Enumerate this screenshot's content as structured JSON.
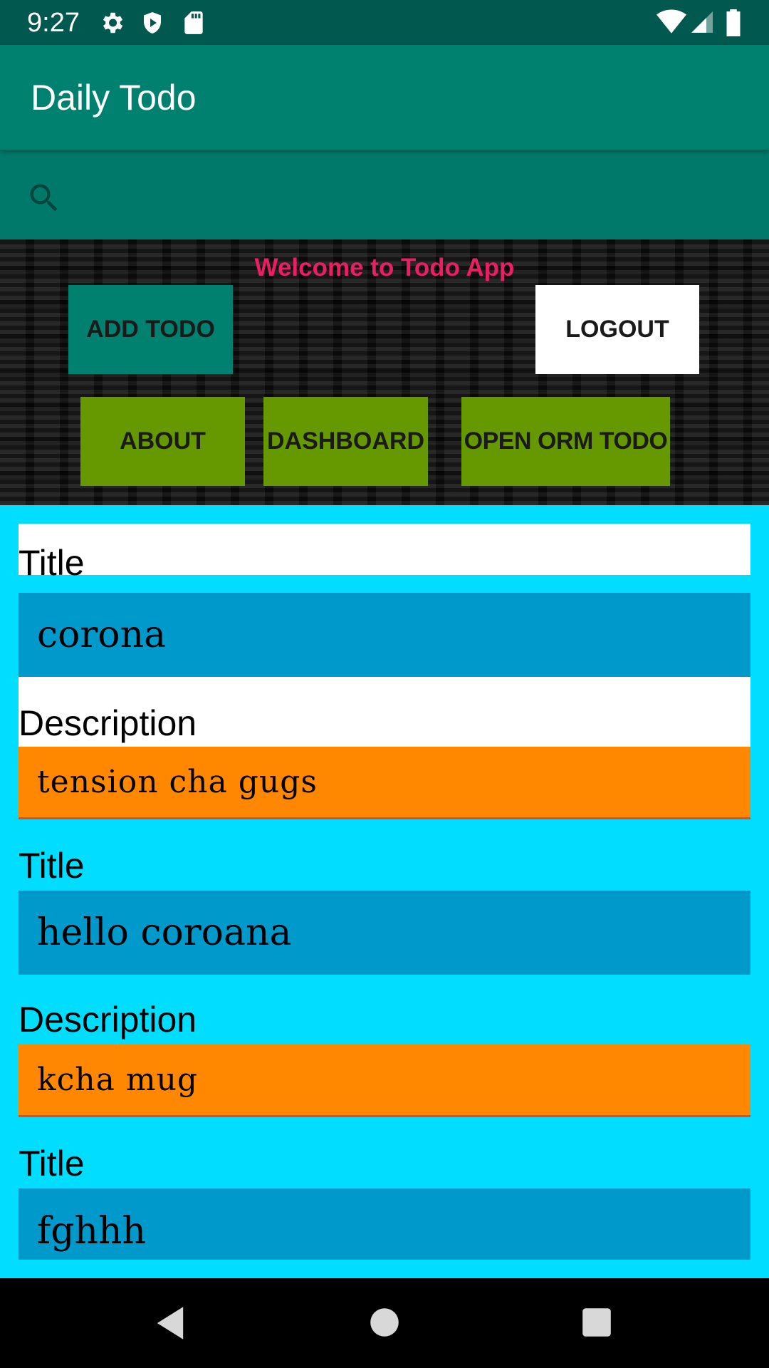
{
  "status_bar": {
    "time": "9:27",
    "left_icons": [
      "gear-icon",
      "shield-icon",
      "sd-card-icon"
    ],
    "right_icons": [
      "wifi-icon",
      "signal-icon",
      "battery-icon"
    ]
  },
  "app_bar": {
    "title": "Daily Todo"
  },
  "search": {
    "placeholder": "",
    "value": ""
  },
  "header": {
    "welcome_text": "Welcome to Todo App",
    "add_todo_label": "ADD TODO",
    "logout_label": "LOGOUT",
    "about_label": "ABOUT",
    "dashboard_label": "DASHBOARD",
    "orm_label": "OPEN ORM TODO"
  },
  "todos": [
    {
      "title_label": "Title",
      "title": "corona",
      "description_label": "Description",
      "description": "tension cha gugs"
    },
    {
      "title_label": "Title",
      "title": "hello coroana",
      "description_label": "Description",
      "description": "kcha mug"
    },
    {
      "title_label": "Title",
      "title": "fghhh"
    }
  ],
  "colors": {
    "status_bar": "#00584f",
    "app_bar": "#00806f",
    "search_bar": "#00796b",
    "welcome_text": "#e91e63",
    "green_button": "#669900",
    "list_background": "#00ddff",
    "title_box": "#0099cc",
    "description_box": "#ff8800"
  },
  "nav_bar": {
    "buttons": [
      "back-icon",
      "home-icon",
      "recents-icon"
    ]
  }
}
